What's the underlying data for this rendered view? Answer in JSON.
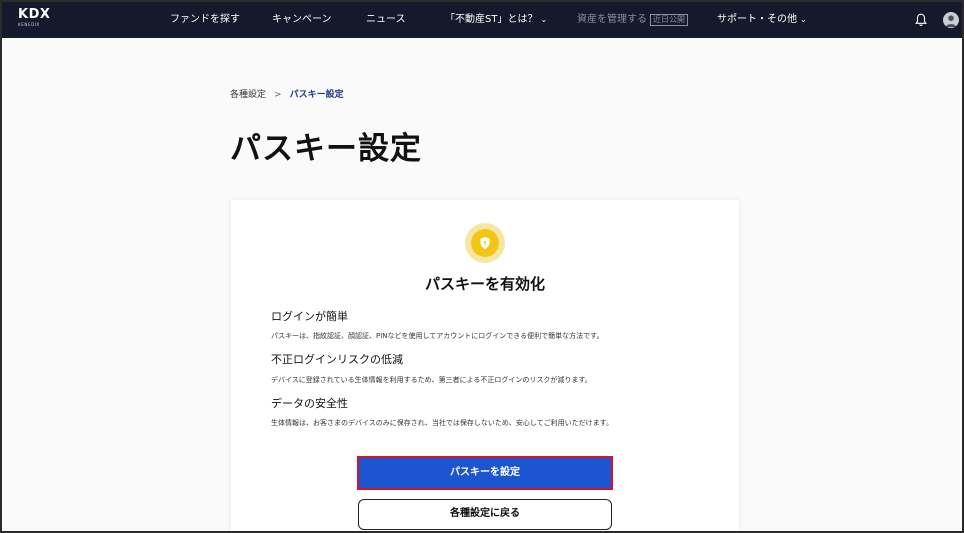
{
  "header": {
    "logo": "KDX",
    "logo_sub": "KENEDIX",
    "nav": {
      "funds": "ファンドを探す",
      "campaign": "キャンペーン",
      "news": "ニュース",
      "about_st": "「不動産ST」とは？",
      "manage_assets": "資産を管理する",
      "manage_badge": "近日公開",
      "support": "サポート・その他"
    },
    "icons": {
      "notifications": "bell-icon",
      "user": "avatar-icon"
    }
  },
  "breadcrumb": {
    "root": "各種設定",
    "separator": ">",
    "current": "パスキー設定"
  },
  "page": {
    "title": "パスキー設定"
  },
  "card": {
    "icon": "shield-icon",
    "title": "パスキーを有効化",
    "features": [
      {
        "heading": "ログインが簡単",
        "description": "パスキーは、指紋認証、顔認証、PINなどを使用してアカウントにログインできる便利で簡単な方法です。"
      },
      {
        "heading": "不正ログインリスクの低減",
        "description": "デバイスに登録されている生体情報を利用するため、第三者による不正ログインのリスクが減ります。"
      },
      {
        "heading": "データの安全性",
        "description": "生体情報は、お客さまのデバイスのみに保存され、当社では保存しないため、安心してご利用いただけます。"
      }
    ],
    "primary_button": "パスキーを設定",
    "secondary_button": "各種設定に戻る"
  },
  "colors": {
    "nav_bg": "#14192b",
    "primary": "#1d55d0",
    "highlight_border": "#d2152a",
    "shield": "#f2c615"
  }
}
